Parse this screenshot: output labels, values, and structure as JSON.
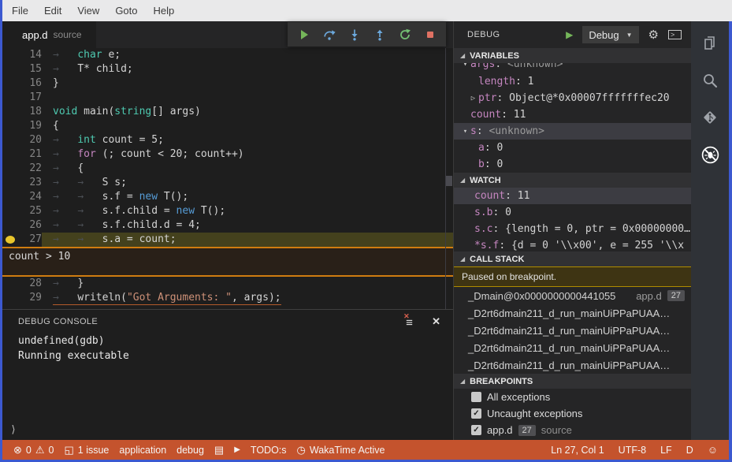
{
  "colors": {
    "window_border": "#3c59d0",
    "status_bar": "#c4532d",
    "breakpoint_dot": "#e9c62c",
    "current_line_bg": "#44411d",
    "widget_border": "#cf7c10",
    "paused_banner_border": "#af8c00",
    "paused_banner_bg": "#3e3413"
  },
  "icons": {
    "error": "⊗",
    "warning": "⚠",
    "issue_box": "◱",
    "doc": "▤",
    "play": "▶",
    "clock": "◷",
    "smiley": "☺",
    "gear": "⚙",
    "close": "✕",
    "caret": "▼",
    "prompt": "⟩",
    "check": "✓",
    "section_arrow": "◢",
    "chevron_open": "▾",
    "chevron_closed": "▷",
    "clear_lines": "≡",
    "clear_x": "✕",
    "console_caret": ">"
  },
  "menu": {
    "items": [
      "File",
      "Edit",
      "View",
      "Goto",
      "Help"
    ]
  },
  "editor_tab": {
    "name": "app.d",
    "description": "source"
  },
  "debug_toolbar": {
    "buttons": [
      {
        "name": "continue"
      },
      {
        "name": "step-over"
      },
      {
        "name": "step-into"
      },
      {
        "name": "step-out"
      },
      {
        "name": "restart"
      },
      {
        "name": "stop"
      }
    ]
  },
  "editor": {
    "current_line": 27,
    "condition_widget": {
      "text": "count > 10",
      "after_line": 27
    },
    "lines": [
      {
        "n": 14,
        "tokens": [
          [
            "w",
            "→   "
          ],
          [
            "k",
            "char"
          ],
          [
            "p",
            " e;"
          ]
        ]
      },
      {
        "n": 15,
        "tokens": [
          [
            "w",
            "→   "
          ],
          [
            "p",
            "T* child;"
          ]
        ]
      },
      {
        "n": 16,
        "tokens": [
          [
            "p",
            "}"
          ]
        ]
      },
      {
        "n": 17,
        "tokens": []
      },
      {
        "n": 18,
        "tokens": [
          [
            "k",
            "void"
          ],
          [
            "p",
            " main("
          ],
          [
            "k",
            "string"
          ],
          [
            "p",
            "[] args)"
          ]
        ]
      },
      {
        "n": 19,
        "tokens": [
          [
            "p",
            "{"
          ]
        ]
      },
      {
        "n": 20,
        "tokens": [
          [
            "w",
            "→   "
          ],
          [
            "k",
            "int"
          ],
          [
            "p",
            " count = 5;"
          ]
        ]
      },
      {
        "n": 21,
        "tokens": [
          [
            "w",
            "→   "
          ],
          [
            "c",
            "for"
          ],
          [
            "p",
            " (; count < 20; count++)"
          ]
        ]
      },
      {
        "n": 22,
        "tokens": [
          [
            "w",
            "→   "
          ],
          [
            "p",
            "{"
          ]
        ]
      },
      {
        "n": 23,
        "tokens": [
          [
            "w",
            "→   "
          ],
          [
            "w",
            "→   "
          ],
          [
            "p",
            "S s;"
          ]
        ]
      },
      {
        "n": 24,
        "tokens": [
          [
            "w",
            "→   "
          ],
          [
            "w",
            "→   "
          ],
          [
            "p",
            "s.f = "
          ],
          [
            "n",
            "new"
          ],
          [
            "p",
            " T();"
          ]
        ]
      },
      {
        "n": 25,
        "tokens": [
          [
            "w",
            "→   "
          ],
          [
            "w",
            "→   "
          ],
          [
            "p",
            "s.f.child = "
          ],
          [
            "n",
            "new"
          ],
          [
            "p",
            " T();"
          ]
        ]
      },
      {
        "n": 26,
        "tokens": [
          [
            "w",
            "→   "
          ],
          [
            "w",
            "→   "
          ],
          [
            "p",
            "s.f.child.d = 4;"
          ]
        ]
      },
      {
        "n": 27,
        "tokens": [
          [
            "w",
            "→   "
          ],
          [
            "w",
            "→   "
          ],
          [
            "p",
            "s.a = count;"
          ]
        ]
      },
      {
        "n": 28,
        "tokens": [
          [
            "w",
            "→   "
          ],
          [
            "p",
            "}"
          ]
        ]
      },
      {
        "n": 29,
        "underline": true,
        "tokens": [
          [
            "w",
            "→   "
          ],
          [
            "p",
            "writeln("
          ],
          [
            "s",
            "\"Got Arguments: \""
          ],
          [
            "p",
            ", args);"
          ]
        ]
      }
    ]
  },
  "debug_console": {
    "title": "DEBUG CONSOLE",
    "lines": [
      "undefined(gdb)",
      "Running executable"
    ],
    "prompt": "⟩"
  },
  "side_panel": {
    "title": "DEBUG",
    "config_name": "Debug",
    "sections": {
      "variables": {
        "label": "VARIABLES",
        "rows": [
          {
            "name": "args",
            "value": "<unknown>",
            "twistie": "open",
            "clipped": true,
            "indent": 0
          },
          {
            "name": "length",
            "value": "1",
            "indent": 1
          },
          {
            "name": "ptr",
            "value": "Object@*0x00007fffffffec20",
            "twistie": "closed",
            "indent": 1
          },
          {
            "name": "count",
            "value": "11",
            "indent": 0
          },
          {
            "name": "s",
            "value": "<unknown>",
            "twistie": "open",
            "selected": true,
            "indent": 0
          },
          {
            "name": "a",
            "value": "0",
            "indent": 1
          },
          {
            "name": "b",
            "value": "0",
            "indent": 1
          }
        ]
      },
      "watch": {
        "label": "WATCH",
        "rows": [
          {
            "name": "count",
            "value": "11",
            "selected": true
          },
          {
            "name": "s.b",
            "value": "0"
          },
          {
            "name": "s.c",
            "value": "{length = 0, ptr = 0x00000000…"
          },
          {
            "name": "*s.f",
            "value": "{d = 0 '\\\\x00', e = 255 '\\\\x",
            "clipped": true
          }
        ]
      },
      "call_stack": {
        "label": "CALL STACK",
        "message": "Paused on breakpoint.",
        "frames": [
          {
            "fn": "_Dmain@0x0000000000441055",
            "file": "app.d",
            "line": "27"
          },
          {
            "fn": "_D2rt6dmain211_d_run_mainUiPPaPUAA…"
          },
          {
            "fn": "_D2rt6dmain211_d_run_mainUiPPaPUAA…"
          },
          {
            "fn": "_D2rt6dmain211_d_run_mainUiPPaPUAA…"
          },
          {
            "fn": "_D2rt6dmain211_d_run_mainUiPPaPUAA…"
          }
        ]
      },
      "breakpoints": {
        "label": "BREAKPOINTS",
        "rows": [
          {
            "checked": false,
            "label": "All exceptions"
          },
          {
            "checked": true,
            "label": "Uncaught exceptions"
          },
          {
            "checked": true,
            "label": "app.d",
            "badge": "27",
            "desc": "source"
          }
        ]
      }
    }
  },
  "activity_bar": {
    "items": [
      {
        "name": "explorer"
      },
      {
        "name": "search"
      },
      {
        "name": "source-control"
      },
      {
        "name": "debug",
        "active": true
      }
    ]
  },
  "status_bar": {
    "errors": "0",
    "warnings": "0",
    "issue": "1 issue",
    "app": "application",
    "mode": "debug",
    "todo": "TODO:s",
    "wakatime": "WakaTime Active",
    "line_col": "Ln 27, Col 1",
    "encoding": "UTF-8",
    "eol": "LF",
    "language": "D"
  }
}
